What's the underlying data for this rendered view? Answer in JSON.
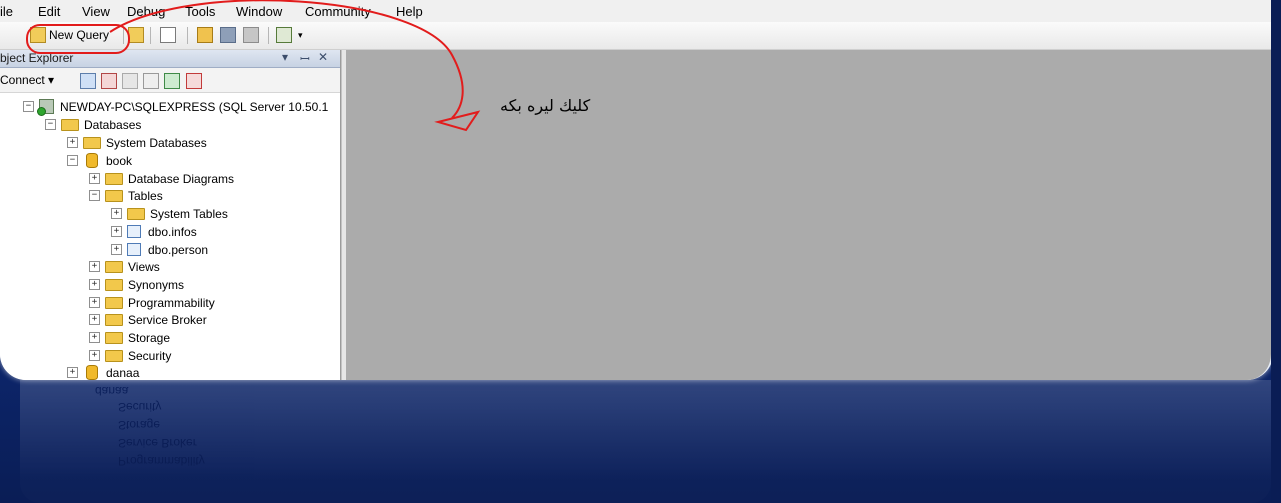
{
  "menu": [
    "ile",
    "Edit",
    "View",
    "Debug",
    "Tools",
    "Window",
    "Community",
    "Help"
  ],
  "toolbar": {
    "new_query_label": "New Query"
  },
  "object_explorer": {
    "title": "bject Explorer",
    "pin": "▾ ♯ ✕",
    "connect_label": "Connect ▾"
  },
  "tree": {
    "server": "NEWDAY-PC\\SQLEXPRESS (SQL Server 10.50.1",
    "databases": "Databases",
    "system_databases": "System Databases",
    "book": "book",
    "database_diagrams": "Database Diagrams",
    "tables": "Tables",
    "system_tables": "System Tables",
    "dbo_infos": "dbo.infos",
    "dbo_person": "dbo.person",
    "views": "Views",
    "synonyms": "Synonyms",
    "programmability": "Programmability",
    "service_broker": "Service Broker",
    "storage": "Storage",
    "security": "Security",
    "danaa": "danaa"
  },
  "annotation": {
    "note": "كليك ليره بكه",
    "color": "#e21c1c"
  },
  "reflection": [
    "danaa",
    "Security",
    "Storage",
    "Service Broker",
    "Programmability"
  ]
}
